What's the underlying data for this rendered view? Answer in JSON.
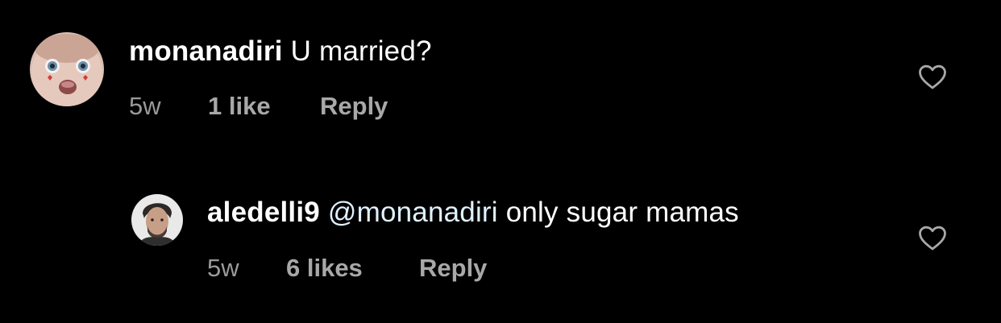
{
  "comments": [
    {
      "username": "monanadiri",
      "text": "U married?",
      "time": "5w",
      "likes": "1 like",
      "reply_label": "Reply",
      "avatar_icon": "baby-face-avatar",
      "heart_icon": "heart-outline-icon"
    },
    {
      "username": "aledelli9",
      "mention": "@monanadiri",
      "text": "only sugar mamas",
      "time": "5w",
      "likes": "6 likes",
      "reply_label": "Reply",
      "avatar_icon": "man-portrait-avatar",
      "heart_icon": "heart-outline-icon"
    }
  ],
  "colors": {
    "background": "#000000",
    "text": "#ffffff",
    "meta": "#a8a8a8",
    "mention": "#e0f1ff"
  }
}
